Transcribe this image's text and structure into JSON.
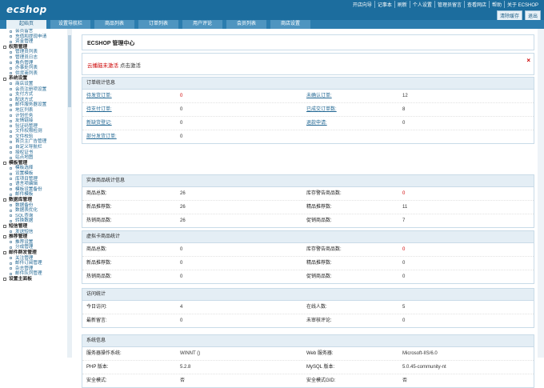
{
  "logo": "ecshop",
  "header": {
    "links": [
      "开店向导",
      "记事本",
      "刷新",
      "个人设置",
      "管理员留言",
      "查看网店",
      "帮助",
      "关于 ECSHOP"
    ],
    "buttons": [
      "清除缓存",
      "退出"
    ]
  },
  "tabs": [
    "起始页",
    "设置导航栏",
    "商品列表",
    "订单列表",
    "用户评论",
    "会员列表",
    "商店设置"
  ],
  "sidebar": [
    {
      "t": "i",
      "label": "会员留言"
    },
    {
      "t": "i",
      "label": "充值和提现申请"
    },
    {
      "t": "i",
      "label": "资金管理"
    },
    {
      "t": "c",
      "label": "权限管理"
    },
    {
      "t": "i",
      "label": "管理员列表"
    },
    {
      "t": "i",
      "label": "管理员日志"
    },
    {
      "t": "i",
      "label": "角色管理"
    },
    {
      "t": "i",
      "label": "办事处列表"
    },
    {
      "t": "i",
      "label": "供货商列表"
    },
    {
      "t": "c",
      "label": "系统设置"
    },
    {
      "t": "i",
      "label": "商店设置"
    },
    {
      "t": "i",
      "label": "会员注册项设置"
    },
    {
      "t": "i",
      "label": "支付方式"
    },
    {
      "t": "i",
      "label": "配送方式"
    },
    {
      "t": "i",
      "label": "邮件服务器设置"
    },
    {
      "t": "i",
      "label": "地区列表"
    },
    {
      "t": "i",
      "label": "计划任务"
    },
    {
      "t": "i",
      "label": "友情链接"
    },
    {
      "t": "i",
      "label": "验证码管理"
    },
    {
      "t": "i",
      "label": "文件权限检测"
    },
    {
      "t": "i",
      "label": "文件校验"
    },
    {
      "t": "i",
      "label": "首页主广告管理"
    },
    {
      "t": "i",
      "label": "自定义导航栏"
    },
    {
      "t": "i",
      "label": "授权证书"
    },
    {
      "t": "i",
      "label": "站点地图"
    },
    {
      "t": "c",
      "label": "模板管理"
    },
    {
      "t": "i",
      "label": "模板选择"
    },
    {
      "t": "i",
      "label": "设置模板"
    },
    {
      "t": "i",
      "label": "库项目管理"
    },
    {
      "t": "i",
      "label": "语言项编辑"
    },
    {
      "t": "i",
      "label": "模板设置备份"
    },
    {
      "t": "i",
      "label": "邮件模板"
    },
    {
      "t": "c",
      "label": "数据库管理"
    },
    {
      "t": "i",
      "label": "数据备份"
    },
    {
      "t": "i",
      "label": "数据表优化"
    },
    {
      "t": "i",
      "label": "SQL查询"
    },
    {
      "t": "i",
      "label": "转换数据"
    },
    {
      "t": "c",
      "label": "短信管理"
    },
    {
      "t": "i",
      "label": "发送短信"
    },
    {
      "t": "c",
      "label": "推荐管理"
    },
    {
      "t": "i",
      "label": "推荐设置"
    },
    {
      "t": "i",
      "label": "分成管理"
    },
    {
      "t": "c",
      "label": "邮件群发管理"
    },
    {
      "t": "i",
      "label": "关注管理"
    },
    {
      "t": "i",
      "label": "邮件订阅管理"
    },
    {
      "t": "i",
      "label": "杂志管理"
    },
    {
      "t": "i",
      "label": "邮件队列管理"
    },
    {
      "t": "c",
      "label": "设置主面板"
    }
  ],
  "page_title": "ECSHOP 管理中心",
  "alert": {
    "text": "云播脑未激活",
    "link": "点击激活",
    "close": "×"
  },
  "sections": [
    {
      "title": "订单统计信息",
      "rows": [
        {
          "l1": "待发货订单:",
          "v1": "0",
          "l2": "未确认订单:",
          "v2": "12",
          "link": true,
          "red1": true
        },
        {
          "l1": "待支付订单:",
          "v1": "0",
          "l2": "已成交订单数:",
          "v2": "8",
          "link": true
        },
        {
          "l1": "新缺货登记:",
          "v1": "0",
          "l2": "退款申请:",
          "v2": "0",
          "link": true
        },
        {
          "l1": "部分发货订单:",
          "v1": "0",
          "l2": "",
          "v2": "",
          "link": true
        }
      ]
    },
    {
      "title": "实体商品统计信息",
      "rows": [
        {
          "l1": "商品总数:",
          "v1": "26",
          "l2": "库存警告商品数:",
          "v2": "0",
          "link": false,
          "red2": true
        },
        {
          "l1": "新品推荐数:",
          "v1": "26",
          "l2": "精品推荐数:",
          "v2": "11",
          "link": false
        },
        {
          "l1": "热销商品数:",
          "v1": "26",
          "l2": "促销商品数:",
          "v2": "7",
          "link": false
        }
      ]
    },
    {
      "title": "虚拟卡商品统计",
      "rows": [
        {
          "l1": "商品总数:",
          "v1": "0",
          "l2": "库存警告商品数:",
          "v2": "0",
          "link": false,
          "red2": true
        },
        {
          "l1": "新品推荐数:",
          "v1": "0",
          "l2": "精品推荐数:",
          "v2": "0",
          "link": false
        },
        {
          "l1": "热销商品数:",
          "v1": "0",
          "l2": "促销商品数:",
          "v2": "0",
          "link": false
        }
      ]
    },
    {
      "title": "访问统计",
      "rows": [
        {
          "l1": "今日访问:",
          "v1": "4",
          "l2": "在线人数:",
          "v2": "5",
          "link": false
        },
        {
          "l1": "最新留言:",
          "v1": "0",
          "l2": "未审核评论:",
          "v2": "0",
          "link": false
        }
      ]
    },
    {
      "title": "系统信息",
      "rows": [
        {
          "l1": "服务器操作系统:",
          "v1": "WINNT ()",
          "l2": "Web 服务器:",
          "v2": "Microsoft-IIS/6.0",
          "link": false
        },
        {
          "l1": "PHP 版本:",
          "v1": "5.2.8",
          "l2": "MySQL 版本:",
          "v2": "5.0.45-community-nt",
          "link": false
        },
        {
          "l1": "安全模式:",
          "v1": "否",
          "l2": "安全模式GID:",
          "v2": "否",
          "link": false
        }
      ]
    }
  ]
}
